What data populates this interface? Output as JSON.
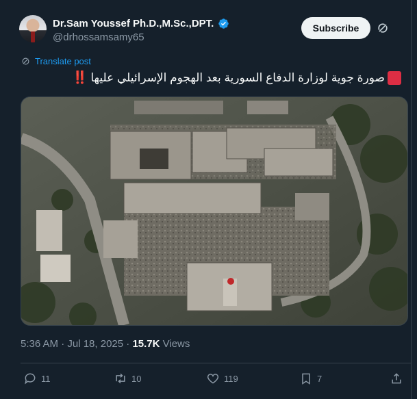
{
  "author": {
    "name": "Dr.Sam Youssef Ph.D.,M.Sc.,DPT.",
    "handle": "@drhossamsamy65"
  },
  "subscribe_label": "Subscribe",
  "translate_label": "Translate post",
  "post": {
    "text": "صورة جوية لوزارة الدفاع السورية بعد الهجوم الإسرائيلي عليها",
    "trailing_emoji": "‼️",
    "media_alt_icon": "aerial-photo"
  },
  "meta": {
    "time": "5:36 AM · Jul 18, 2025 · ",
    "views_count": "15.7K",
    "views_label": " Views"
  },
  "actions": {
    "replies": "11",
    "reposts": "10",
    "likes": "119",
    "bookmarks": "7"
  },
  "colors": {
    "background": "#15202b",
    "accent": "#1d9bf0",
    "muted": "#8b98a5",
    "verified": "#1d9bf0"
  },
  "icons": [
    "verified-badge-icon",
    "grok-icon",
    "more-icon",
    "translate-icon",
    "reply-icon",
    "repost-icon",
    "like-icon",
    "bookmark-icon",
    "share-icon"
  ]
}
